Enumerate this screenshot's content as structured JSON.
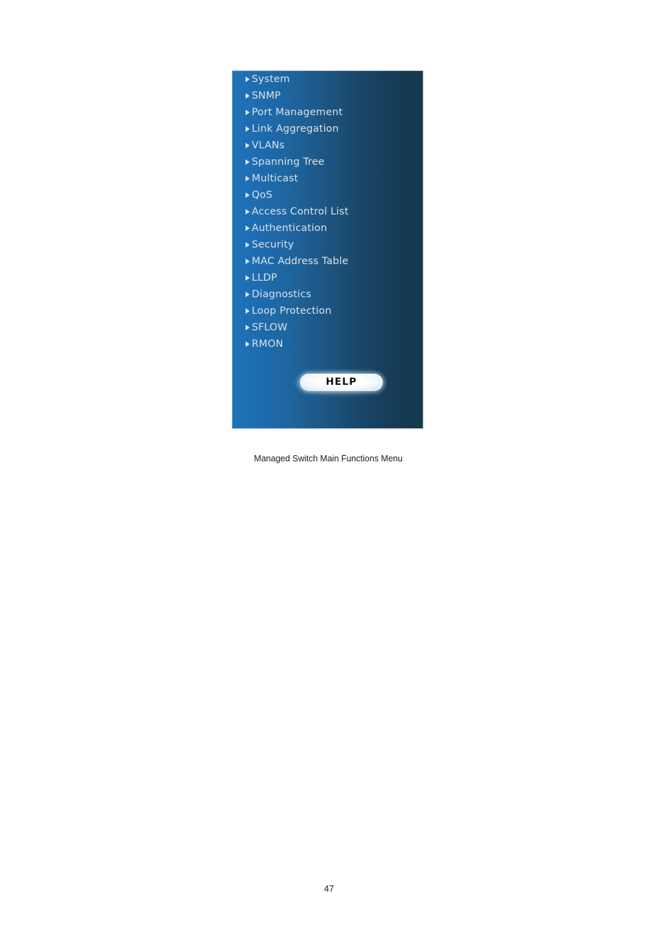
{
  "document": {
    "page_number": "47"
  },
  "figure": {
    "caption": "Managed Switch Main Functions Menu",
    "panel": {
      "gradient_start": "#1f72b8",
      "gradient_end": "#15394f",
      "border_color": "#b9bdc1",
      "text_color": "#dde2e6",
      "bullet_icon": "triangle-right-icon"
    },
    "menu": {
      "items": [
        {
          "label": "System"
        },
        {
          "label": "SNMP"
        },
        {
          "label": "Port Management"
        },
        {
          "label": "Link Aggregation"
        },
        {
          "label": "VLANs"
        },
        {
          "label": "Spanning Tree"
        },
        {
          "label": "Multicast"
        },
        {
          "label": "QoS"
        },
        {
          "label": "Access Control List"
        },
        {
          "label": "Authentication"
        },
        {
          "label": "Security"
        },
        {
          "label": "MAC Address Table"
        },
        {
          "label": "LLDP"
        },
        {
          "label": "Diagnostics"
        },
        {
          "label": "Loop Protection"
        },
        {
          "label": "SFLOW"
        },
        {
          "label": "RMON"
        }
      ]
    },
    "help_button": {
      "label": "HELP",
      "text_color": "#111111",
      "fill_color": "#ffffff"
    }
  }
}
